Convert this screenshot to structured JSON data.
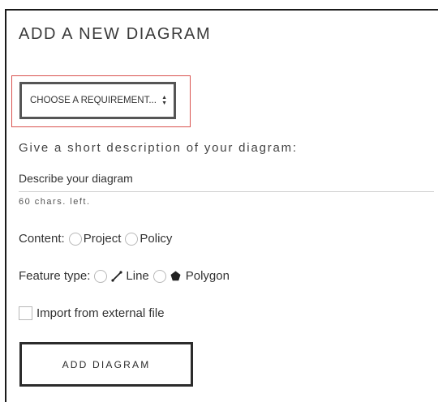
{
  "form": {
    "title": "ADD A NEW DIAGRAM",
    "requirement_select": {
      "selected": "CHOOSE A REQUIREMENT..."
    },
    "description": {
      "label": "Give a short description of your diagram:",
      "placeholder": "Describe your diagram",
      "value": "",
      "chars_left": "60 chars. left."
    },
    "content": {
      "label": "Content:",
      "options": [
        "Project",
        "Policy"
      ]
    },
    "feature_type": {
      "label": "Feature type:",
      "options": [
        {
          "label": "Line",
          "icon": "line-icon"
        },
        {
          "label": "Polygon",
          "icon": "polygon-icon"
        }
      ]
    },
    "import": {
      "label": "Import from external file",
      "checked": false
    },
    "submit_label": "ADD DIAGRAM"
  },
  "colors": {
    "highlight_border": "#d9534f",
    "border_dark": "#2b2b2b"
  }
}
